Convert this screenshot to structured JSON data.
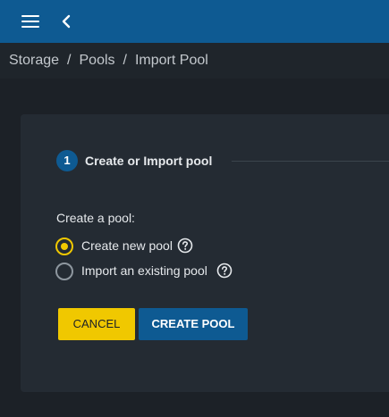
{
  "topbar": {
    "menu_icon": "hamburger-menu-icon",
    "back_icon": "chevron-left-icon"
  },
  "breadcrumb": {
    "items": [
      "Storage",
      "Pools",
      "Import Pool"
    ],
    "separator": "/"
  },
  "stepper": {
    "step_number": "1",
    "step_label": "Create or Import pool"
  },
  "form": {
    "section_label": "Create a pool:",
    "options": [
      {
        "label": "Create new pool",
        "selected": true
      },
      {
        "label": "Import an existing pool",
        "selected": false
      }
    ],
    "help_icon": "question-circle-icon"
  },
  "actions": {
    "cancel_label": "CANCEL",
    "create_label": "CREATE POOL"
  },
  "colors": {
    "topbar": "#0e5a92",
    "accent_yellow": "#f0c800",
    "primary_blue": "#0e5a92",
    "card_bg": "#242b33",
    "page_bg": "#1c2127"
  }
}
